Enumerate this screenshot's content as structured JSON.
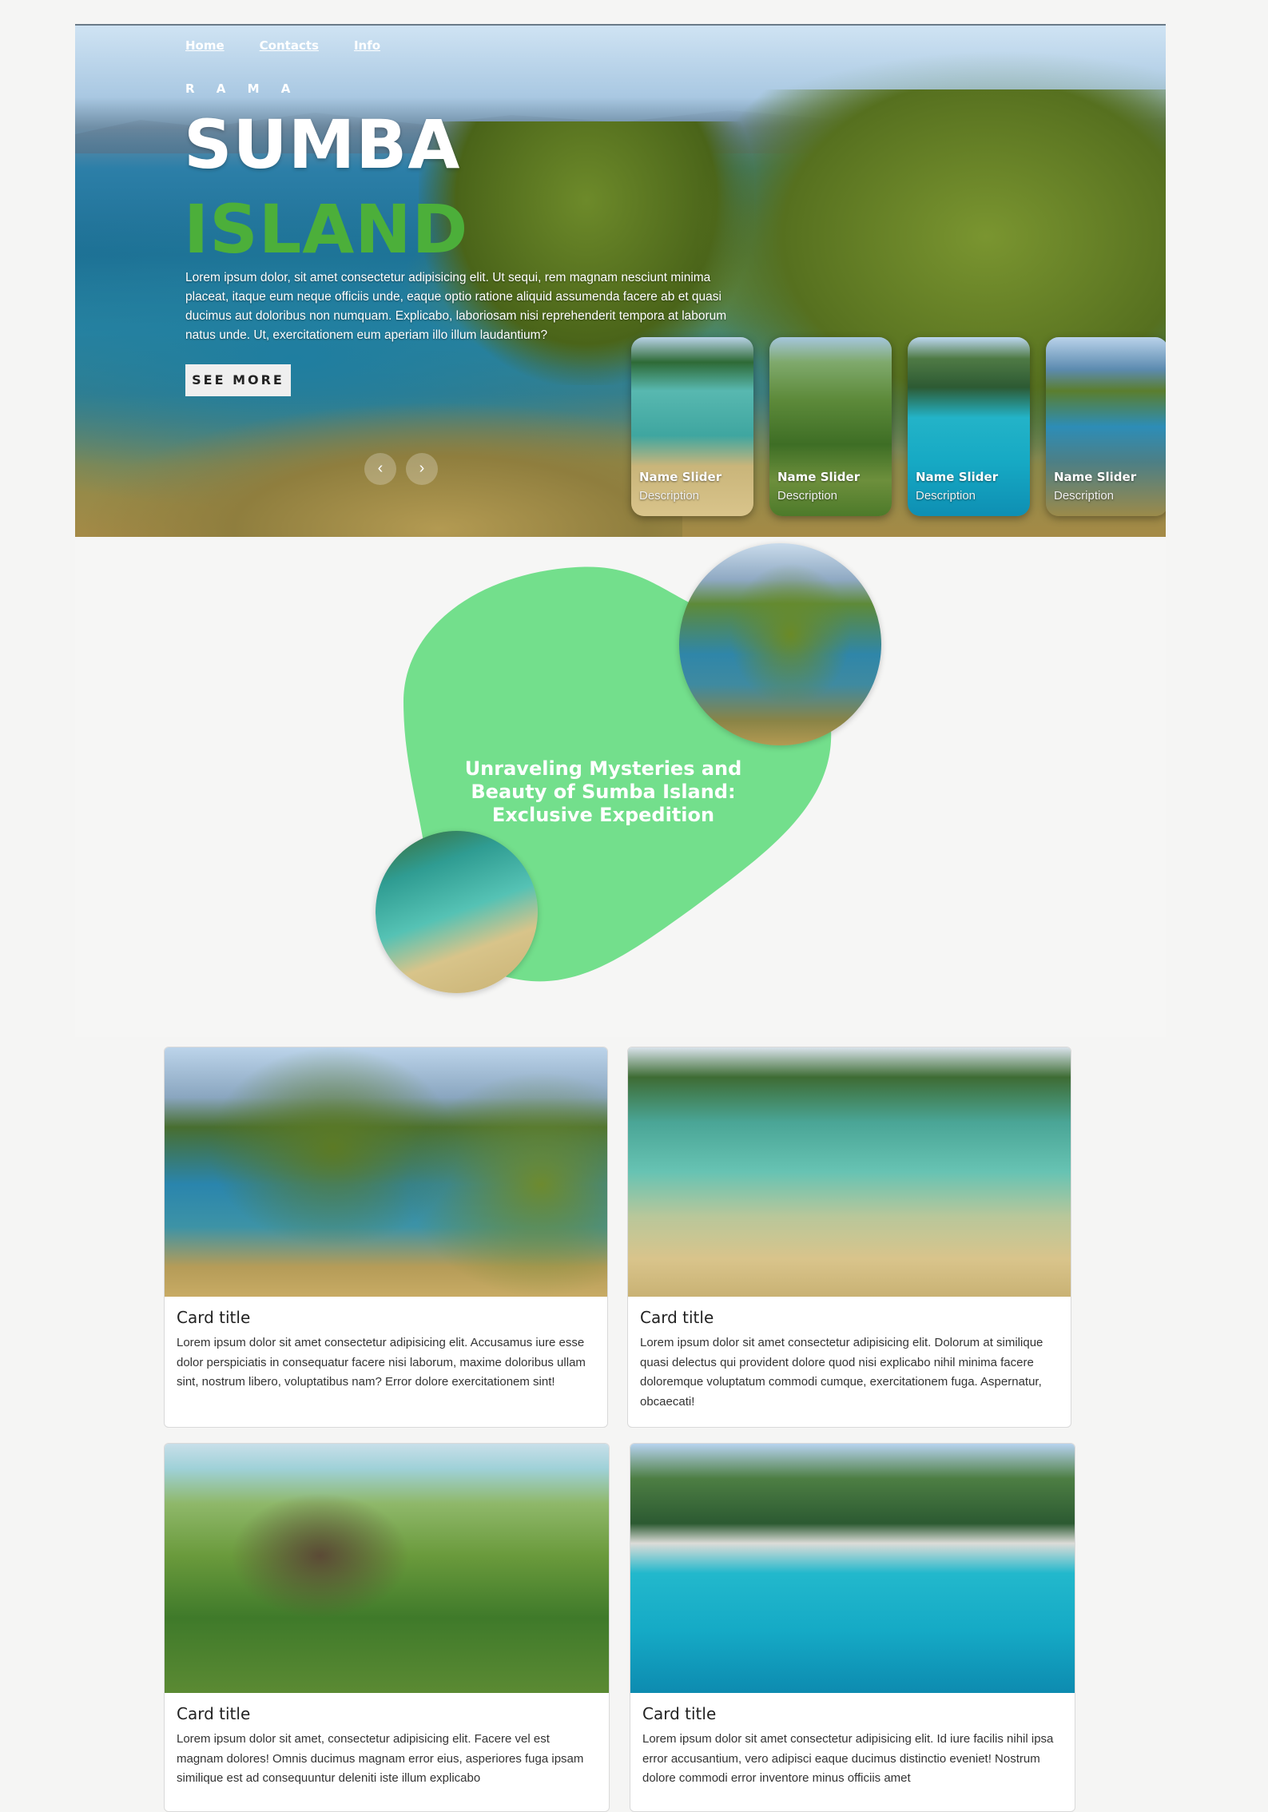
{
  "nav": {
    "links": [
      "Home",
      "Contacts",
      "Info"
    ]
  },
  "hero": {
    "brand": "R A M A",
    "title_line1": "SUMBA",
    "title_line2": "ISLAND",
    "description": "Lorem ipsum dolor, sit amet consectetur adipisicing elit. Ut sequi, rem magnam nesciunt minima placeat, itaque eum neque officiis unde, eaque optio ratione aliquid assumenda facere ab et quasi ducimus aut doloribus non numquam. Explicabo, laboriosam nisi reprehenderit tempora at laborum natus unde. Ut, exercitationem eum aperiam illo illum laudantium?",
    "button_label": "SEE MORE",
    "prev_arrow": "‹",
    "next_arrow": "›",
    "title_colors": {
      "line1": "#ffffff",
      "line2": "#4caf3a"
    }
  },
  "slider": {
    "items": [
      {
        "name": "Name Slider",
        "description": "Description"
      },
      {
        "name": "Name Slider",
        "description": "Description"
      },
      {
        "name": "Name Slider",
        "description": "Description"
      },
      {
        "name": "Name Slider",
        "description": "Description"
      }
    ]
  },
  "feature": {
    "title": "Unraveling Mysteries and Beauty of Sumba Island: Exclusive Expedition",
    "blob_color": "#73df8c"
  },
  "cards": [
    {
      "title": "Card title",
      "text": "Lorem ipsum dolor sit amet consectetur adipisicing elit. Accusamus iure esse dolor perspiciatis in consequatur facere nisi laborum, maxime doloribus ullam sint, nostrum libero, voluptatibus nam? Error dolore exercitationem sint!"
    },
    {
      "title": "Card title",
      "text": "Lorem ipsum dolor sit amet consectetur adipisicing elit. Dolorum at similique quasi delectus qui provident dolore quod nisi explicabo nihil minima facere doloremque voluptatum commodi cumque, exercitationem fuga. Aspernatur, obcaecati!"
    },
    {
      "title": "Card title",
      "text": "Lorem ipsum dolor sit amet, consectetur adipisicing elit. Facere vel est magnam dolores! Omnis ducimus magnam error eius, asperiores fuga ipsam similique est ad consequuntur deleniti iste illum explicabo"
    },
    {
      "title": "Card title",
      "text": "Lorem ipsum dolor sit amet consectetur adipisicing elit. Id iure facilis nihil ipsa error accusantium, vero adipisci eaque ducimus distinctio eveniet! Nostrum dolore commodi error inventore minus officiis amet"
    }
  ]
}
